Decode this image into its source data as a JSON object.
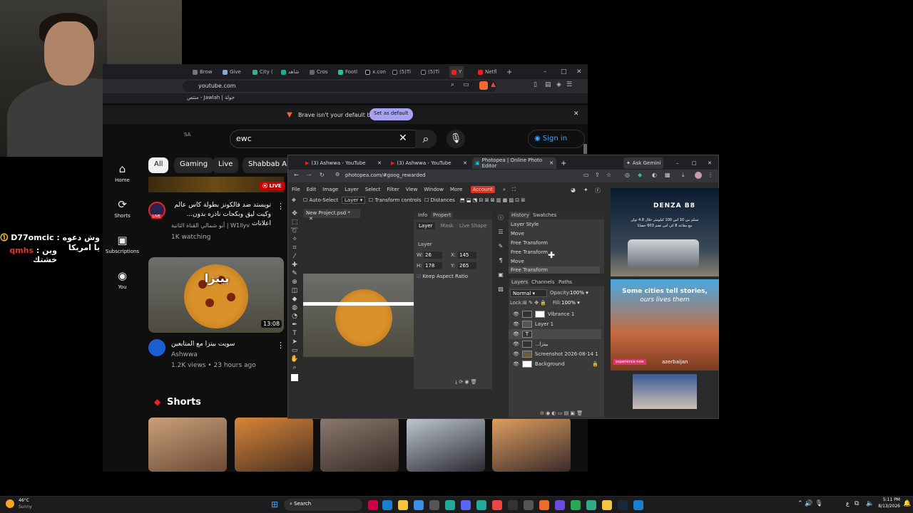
{
  "chat": {
    "messages": [
      {
        "user": "D77omcic",
        "sep": " :",
        "text": "وش دعوه يا امريكا",
        "color": "#f5c542"
      },
      {
        "user": "qmhs",
        "sep": " :",
        "text": "وين خشتك",
        "color": "#e0342f"
      }
    ]
  },
  "yt_browser": {
    "tabs": [
      "Brow",
      "Give",
      "City (",
      "شاهد",
      "Cros",
      "Footl",
      "x.con",
      "(5)Ti",
      "(5)Ti",
      "Y",
      "Netfl"
    ],
    "url": "youtube.com",
    "bookmark_bar": "منتص - Jawlah | جولة",
    "brave_banner": "Brave isn't your default browser",
    "set_default": "Set as default",
    "search_query": "ewc",
    "sign_in": "Sign in",
    "region_label": "SA",
    "chips": [
      "All",
      "Gaming",
      "Live",
      "Shabbab Albe"
    ],
    "sidebar": [
      {
        "icon": "⌂",
        "label": "Home"
      },
      {
        "icon": "⟳",
        "label": "Shorts"
      },
      {
        "icon": "▣",
        "label": "Subscriptions"
      },
      {
        "icon": "◉",
        "label": "You"
      }
    ],
    "live_badge": "LIVE",
    "live_video": {
      "title_line1": "تويستد ضد فالكونز بطولة كاس عالم",
      "title_line2": "...وكيت ليق وبكجات ناذره بدون اعلانات",
      "channel": "أبو شمالي القناة الثانية | W1llyv",
      "meta": "1K watching",
      "avatar_badge": "LIVE"
    },
    "video2": {
      "title": "سويت بيتزا مع المتابعين",
      "channel": "Ashwwa",
      "meta": "1.2K views • 23 hours ago",
      "duration": "13:08",
      "overlay": "بيتزا"
    },
    "shorts_title": "Shorts"
  },
  "photopea": {
    "tabs": [
      "(3) Ashwwa - YouTube",
      "(3) Ashwwa - YouTube",
      "Photopea | Online Photo Editor"
    ],
    "ask_gemini": "Ask Gemini",
    "url": "photopea.com/#goog_rewarded",
    "menu": [
      "File",
      "Edit",
      "Image",
      "Layer",
      "Select",
      "Filter",
      "View",
      "Window",
      "More"
    ],
    "account": "Account",
    "toolbar": {
      "auto_select": "Auto-Select",
      "layer_select": "Layer",
      "transform_controls": "Transform controls",
      "distances": "Distances"
    },
    "doc_tab": "New Project.psd *",
    "info_tabs": [
      "Info",
      "Propert"
    ],
    "props_tabs": [
      "Layer",
      "Mask",
      "Live Shape"
    ],
    "props_section": "Layer",
    "props": {
      "w": "26",
      "x": "145",
      "h": "178",
      "y": "265"
    },
    "keep_aspect": "Keep Aspect Ratio",
    "history_tabs": [
      "History",
      "Swatches"
    ],
    "history": [
      "Layer Style",
      "Move",
      "Free Transform",
      "Free Transform",
      "Move",
      "Free Transform"
    ],
    "layers_tabs": [
      "Layers",
      "Channels",
      "Paths"
    ],
    "blend_mode": "Normal",
    "opacity_label": "Opacity:",
    "opacity": "100%",
    "lock_label": "Lock:",
    "fill_label": "Fill:",
    "fill": "100%",
    "layers": [
      "Vibrance 1",
      "Layer 1",
      "T",
      "...بيتزا",
      "Screenshot 2026-08-14 1",
      "Background"
    ],
    "ad1": {
      "brand": "DENZA B8",
      "text": "تسلم من 10 اس 100 كيلومتر خلال 4.8 ثوان",
      "sub": "مع مقاعد 8 كي اس تضم 603 حصانا"
    },
    "ad2": {
      "headline": "Some cities tell stories,",
      "sub": "ours lives them",
      "cta": "experience now",
      "brand": "azerbaijan"
    }
  },
  "taskbar": {
    "weather_temp": "46°C",
    "weather_desc": "Sunny",
    "search": "Search",
    "time": "5:11 PM",
    "date": "8/13/2026",
    "lang": "ع"
  }
}
